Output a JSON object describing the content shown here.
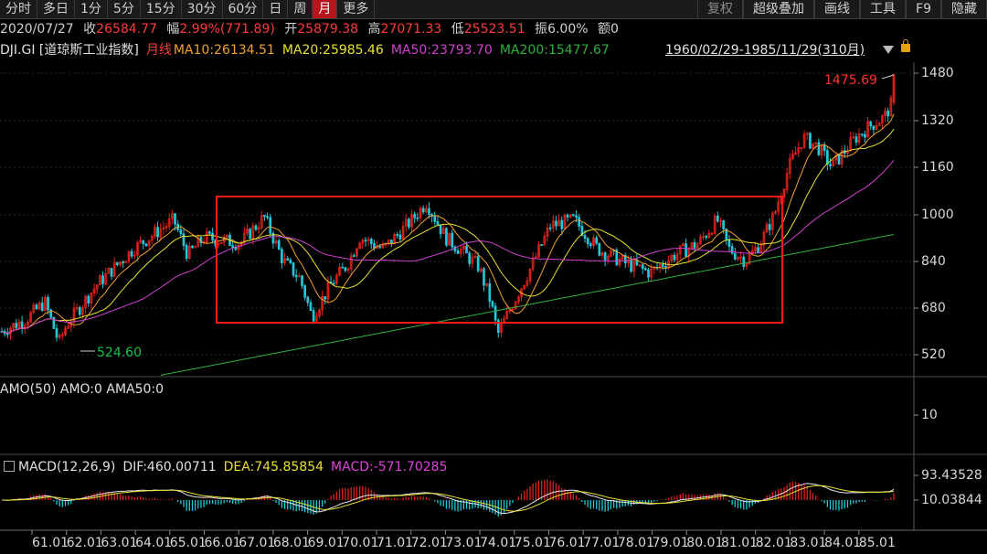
{
  "toolbar": {
    "items": [
      {
        "label": "分时",
        "active": false
      },
      {
        "label": "多日",
        "active": false
      },
      {
        "label": "1分",
        "active": false
      },
      {
        "label": "5分",
        "active": false
      },
      {
        "label": "15分",
        "active": false
      },
      {
        "label": "30分",
        "active": false
      },
      {
        "label": "60分",
        "active": false
      },
      {
        "label": "日",
        "active": false
      },
      {
        "label": "周",
        "active": false
      },
      {
        "label": "月",
        "active": true
      },
      {
        "label": "更多",
        "active": false
      }
    ],
    "right_items": [
      "复权",
      "超级叠加",
      "画线",
      "工具",
      "F9",
      "隐藏"
    ]
  },
  "quote": {
    "date": "2020/07/27",
    "close_label": "收",
    "close": "26584.77",
    "amp_label": "幅",
    "amp": "2.99%(771.89)",
    "open_label": "开",
    "open": "25879.38",
    "high_label": "高",
    "high": "27071.33",
    "low_label": "低",
    "low": "25523.51",
    "swing_label": "振",
    "swing": "6.00%",
    "amount_label": "额",
    "amount": "0"
  },
  "ma_line": {
    "symbol": "DJI.GI [道琼斯工业指数]",
    "period": "月线",
    "ma10": "MA10:26134.51",
    "ma20": "MA20:25985.46",
    "ma50": "MA50:23793.70",
    "ma200": "MA200:15477.67",
    "range": "1960/02/29-1985/11/29(310月)"
  },
  "colors": {
    "ma10": "#f0a030",
    "ma20": "#e8e030",
    "ma50": "#d040d0",
    "ma200": "#30b040",
    "up": "#e0201a",
    "down": "#20c8d8",
    "box": "#ff1a1a"
  },
  "price_chart": {
    "y_ticks": [
      "1480",
      "1320",
      "1160",
      "1000",
      "840",
      "680",
      "520"
    ],
    "max_label": "1475.69",
    "min_label": "524.60"
  },
  "amo_panel": {
    "label": "AMO(50)  AMO:0  AMA50:0",
    "y_tick": "10"
  },
  "macd_panel": {
    "label_name": "MACD(12,26,9)",
    "dif": "DIF:460.00711",
    "dea": "DEA:745.85854",
    "macd": "MACD:-571.70285",
    "y_ticks": [
      "93.43528",
      "10.03844"
    ]
  },
  "x_axis": {
    "ticks": [
      "61.01",
      "62.01",
      "63.01",
      "64.01",
      "65.01",
      "66.01",
      "67.01",
      "68.01",
      "69.01",
      "70.01",
      "71.01",
      "72.01",
      "73.01",
      "74.01",
      "75.01",
      "76.01",
      "77.01",
      "78.01",
      "79.01",
      "80.01",
      "81.01",
      "82.01",
      "83.01",
      "84.01",
      "85.01"
    ]
  }
}
